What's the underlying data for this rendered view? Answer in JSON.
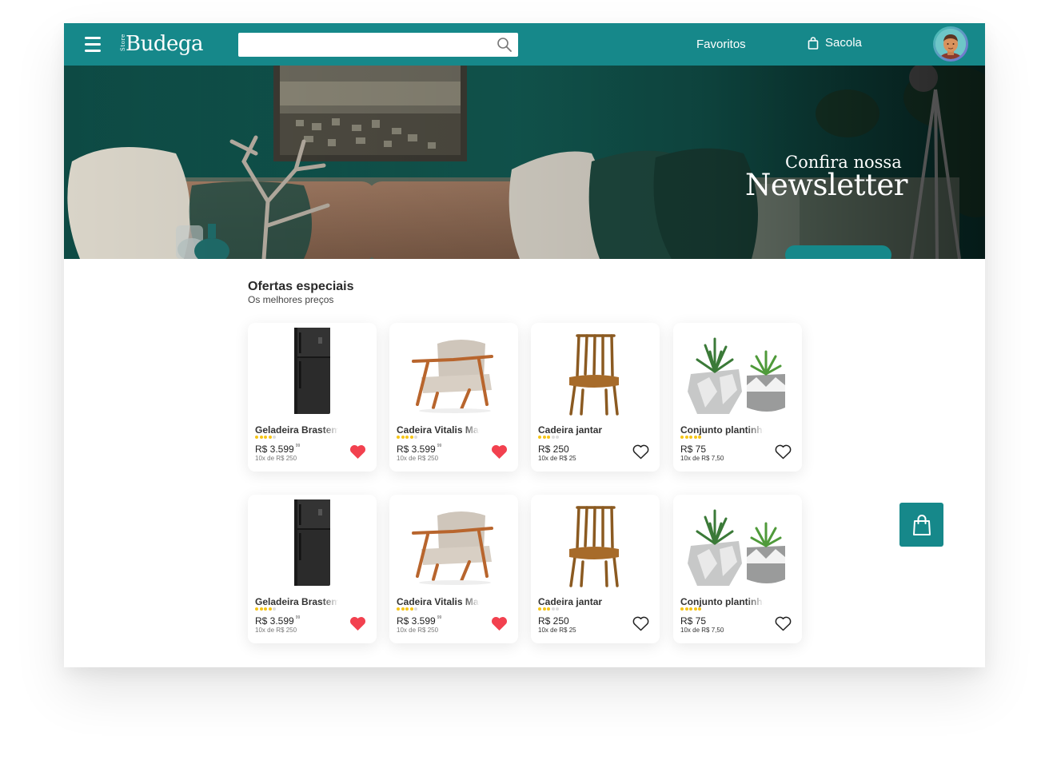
{
  "header": {
    "logo_small": "Store",
    "logo_main": "Budega",
    "search_placeholder": "",
    "favorites_label": "Favoritos",
    "bag_label": "Sacola"
  },
  "hero": {
    "kicker": "Confira nossa",
    "title": "Newsletter",
    "button_label": ""
  },
  "offers": {
    "title": "Ofertas especiais",
    "subtitle": "Os melhores preços"
  },
  "products": [
    {
      "name": "Geladeira Brastemp",
      "price": "R$ 3.599",
      "cents": "99",
      "installment": "10x de R$ 250",
      "rating": 4,
      "favorite": true
    },
    {
      "name": "Cadeira Vitalis Madeira",
      "price": "R$ 3.599",
      "cents": "99",
      "installment": "10x de R$ 250",
      "rating": 4,
      "favorite": true
    },
    {
      "name": "Cadeira jantar",
      "price": "R$ 250",
      "cents": "",
      "installment": "10x de R$ 25",
      "rating": 3,
      "favorite": false
    },
    {
      "name": "Conjunto plantinhas",
      "price": "R$ 75",
      "cents": "",
      "installment": "10x de R$ 7,50",
      "rating": 5,
      "favorite": false
    },
    {
      "name": "Geladeira Brastemp",
      "price": "R$ 3.599",
      "cents": "99",
      "installment": "10x de R$ 250",
      "rating": 4,
      "favorite": true
    },
    {
      "name": "Cadeira Vitalis Madeira",
      "price": "R$ 3.599",
      "cents": "99",
      "installment": "10x de R$ 250",
      "rating": 4,
      "favorite": true
    },
    {
      "name": "Cadeira jantar",
      "price": "R$ 250",
      "cents": "",
      "installment": "10x de R$ 25",
      "rating": 3,
      "favorite": false
    },
    {
      "name": "Conjunto plantinhas",
      "price": "R$ 75",
      "cents": "",
      "installment": "10x de R$ 7,50",
      "rating": 5,
      "favorite": false
    }
  ],
  "colors": {
    "brand": "#16888a",
    "heart_active": "#f2414f",
    "star": "#f5c518"
  }
}
